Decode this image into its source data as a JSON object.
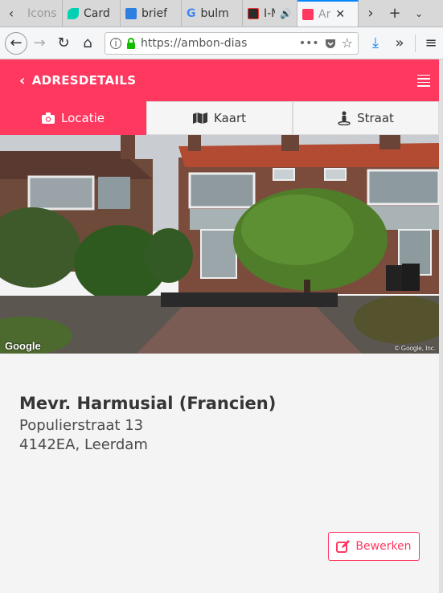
{
  "browser": {
    "tabs": [
      {
        "label": "Icons",
        "favicon_color": "#bdbdbd"
      },
      {
        "label": "Card",
        "favicon_color": "#00d1b2"
      },
      {
        "label": "brief",
        "favicon_color": "#2d7fe0"
      },
      {
        "label": "bulm",
        "favicon_color": "#4285f4"
      },
      {
        "label": "I-M",
        "favicon_color": "#2b2b2b"
      },
      {
        "label": "Ar",
        "favicon_color": "#ff3860"
      }
    ],
    "url": "https://ambon-dias"
  },
  "app": {
    "title": "ADRESDETAILS",
    "accent": "#ff3860"
  },
  "tabs": [
    {
      "label": "Locatie",
      "icon": "camera-icon",
      "active": true
    },
    {
      "label": "Kaart",
      "icon": "map-icon",
      "active": false
    },
    {
      "label": "Straat",
      "icon": "street-view-icon",
      "active": false
    }
  ],
  "photo": {
    "provider_mark": "Google",
    "copyright": "© Google, Inc."
  },
  "contact": {
    "name": "Mevr. Harmusial (Francien)",
    "street": "Populierstraat 13",
    "city_line": "4142EA, Leerdam"
  },
  "actions": {
    "edit_label": "Bewerken"
  }
}
